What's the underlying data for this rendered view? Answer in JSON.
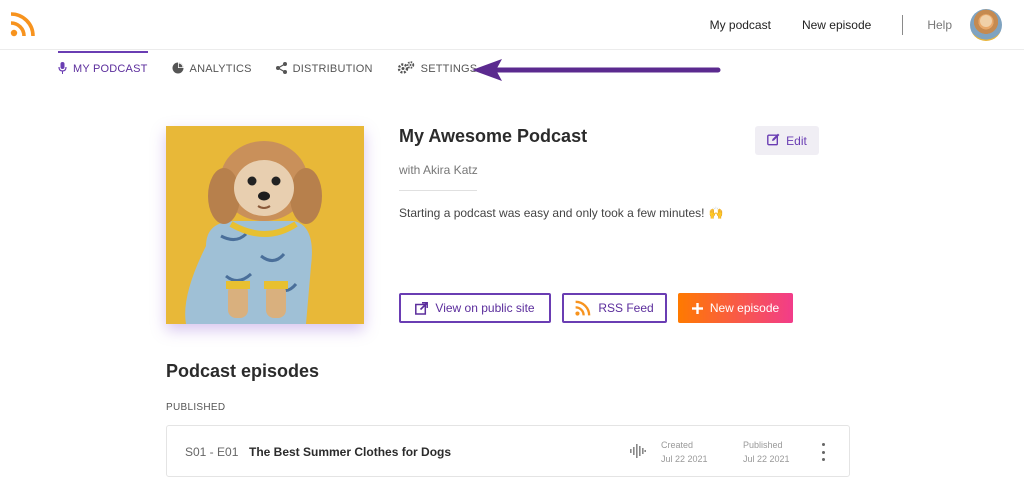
{
  "topnav": {
    "my_podcast": "My podcast",
    "new_episode": "New episode",
    "help": "Help"
  },
  "tabs": [
    {
      "label": "MY PODCAST",
      "icon": "microphone-icon",
      "active": true
    },
    {
      "label": "ANALYTICS",
      "icon": "pie-chart-icon",
      "active": false
    },
    {
      "label": "DISTRIBUTION",
      "icon": "share-icon",
      "active": false
    },
    {
      "label": "SETTINGS",
      "icon": "gears-icon",
      "active": false
    }
  ],
  "podcast": {
    "title": "My Awesome Podcast",
    "byline": "with Akira Katz",
    "description": "Starting a podcast was easy and only took a few minutes!",
    "emoji": "🙌",
    "edit_label": "Edit"
  },
  "actions": {
    "view_public": "View on public site",
    "rss_feed": "RSS Feed",
    "new_episode": "New episode"
  },
  "episodes_section": {
    "title": "Podcast episodes",
    "published_label": "PUBLISHED",
    "items": [
      {
        "code": "S01 - E01",
        "title": "The Best Summer Clothes for Dogs",
        "created_label": "Created",
        "created_date": "Jul 22 2021",
        "published_label": "Published",
        "published_date": "Jul 22 2021"
      }
    ]
  },
  "colors": {
    "accent_purple": "#6a3db3",
    "rss_orange": "#f7931e",
    "gradient_start": "#ff7a00",
    "gradient_end": "#f23c8a"
  }
}
